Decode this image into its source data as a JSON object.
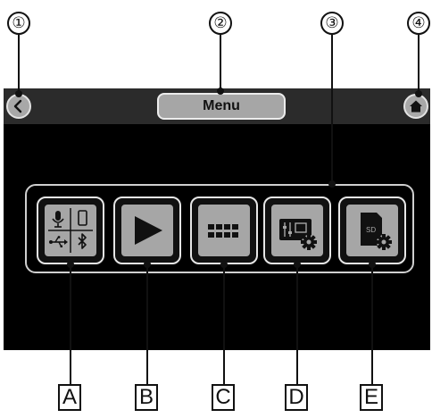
{
  "callouts": [
    "①",
    "②",
    "③",
    "④"
  ],
  "header": {
    "title": "Menu"
  },
  "tiles": [
    {
      "letter": "A",
      "icon": "input-settings-icon",
      "sd_text": ""
    },
    {
      "letter": "B",
      "icon": "play-icon",
      "sd_text": ""
    },
    {
      "letter": "C",
      "icon": "grid-icon",
      "sd_text": ""
    },
    {
      "letter": "D",
      "icon": "mixer-settings-icon",
      "sd_text": ""
    },
    {
      "letter": "E",
      "icon": "sd-card-settings-icon",
      "sd_text": "SD"
    }
  ],
  "colors": {
    "screen": "#000000",
    "topbar": "#2b2b2b",
    "button": "#a6a6a6",
    "outline": "#e6e6e6"
  }
}
